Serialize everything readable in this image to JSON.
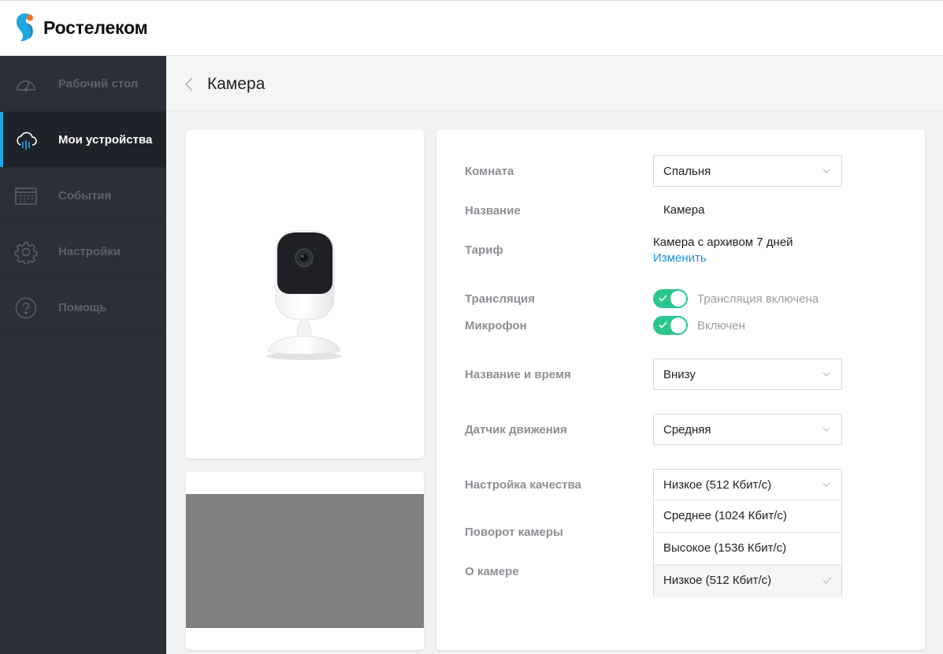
{
  "brand": {
    "name": "Ростелеком",
    "accent": "#1ea7e1",
    "toggle_color": "#2bc58e",
    "link_color": "#1f8fe0"
  },
  "sidebar": {
    "items": [
      {
        "label": "Рабочий стол",
        "icon": "dashboard-gauge-icon",
        "active": false
      },
      {
        "label": "Мои устройства",
        "icon": "cloud-devices-icon",
        "active": true
      },
      {
        "label": "События",
        "icon": "calendar-events-icon",
        "active": false
      },
      {
        "label": "Настройки",
        "icon": "gear-icon",
        "active": false
      },
      {
        "label": "Помощь",
        "icon": "help-question-icon",
        "active": false
      }
    ]
  },
  "page": {
    "title": "Камера"
  },
  "settings": {
    "room": {
      "label": "Комната",
      "value": "Спальня"
    },
    "name": {
      "label": "Название",
      "value": "Камера"
    },
    "tariff": {
      "label": "Тариф",
      "value": "Камера с архивом 7 дней",
      "link": "Изменить"
    },
    "stream": {
      "label": "Трансляция",
      "status": "Трансляция включена",
      "enabled": true
    },
    "mic": {
      "label": "Микрофон",
      "status": "Включен",
      "enabled": true
    },
    "overlay": {
      "label": "Название и время",
      "value": "Внизу"
    },
    "motion": {
      "label": "Датчик движения",
      "value": "Средняя"
    },
    "quality": {
      "label": "Настройка качества",
      "value": "Низкое (512 Кбит/с)",
      "options": [
        "Среднее (1024 Кбит/с)",
        "Высокое (1536 Кбит/с)",
        "Низкое (512 Кбит/с)"
      ],
      "checked_index": 2
    },
    "rotation": {
      "label": "Поворот камеры"
    },
    "about": {
      "label": "О камере"
    }
  }
}
